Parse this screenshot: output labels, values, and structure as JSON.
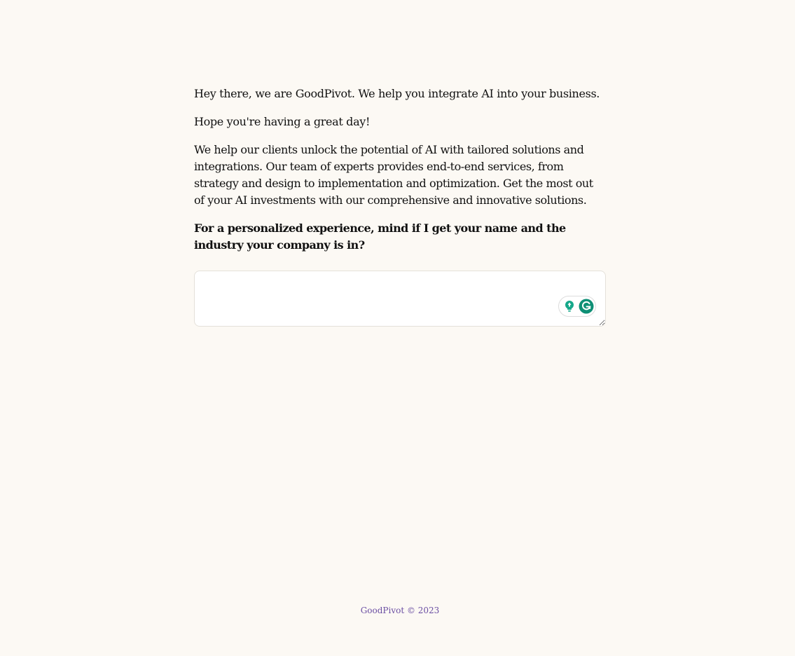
{
  "intro": {
    "line1": "Hey there, we are GoodPivot. We help you integrate AI into your business.",
    "line2": "Hope you're having a great day!",
    "description": "We help our clients unlock the potential of AI with tailored solutions and integrations. Our team of experts provides end-to-end services, from strategy and design to implementation and optimization. Get the most out of your AI investments with our comprehensive and innovative solutions."
  },
  "question": "For a personalized experience, mind if I get your name and the industry your company is in?",
  "answer_input": {
    "value": "",
    "placeholder": ""
  },
  "assist_icons": [
    "lightbulb-icon",
    "grammarly-icon"
  ],
  "footer": {
    "text": "GoodPivot © 2023"
  },
  "colors": {
    "background": "#fcf9f4",
    "footer_text": "#6b4fa3",
    "assist_green": "#15a88a"
  }
}
